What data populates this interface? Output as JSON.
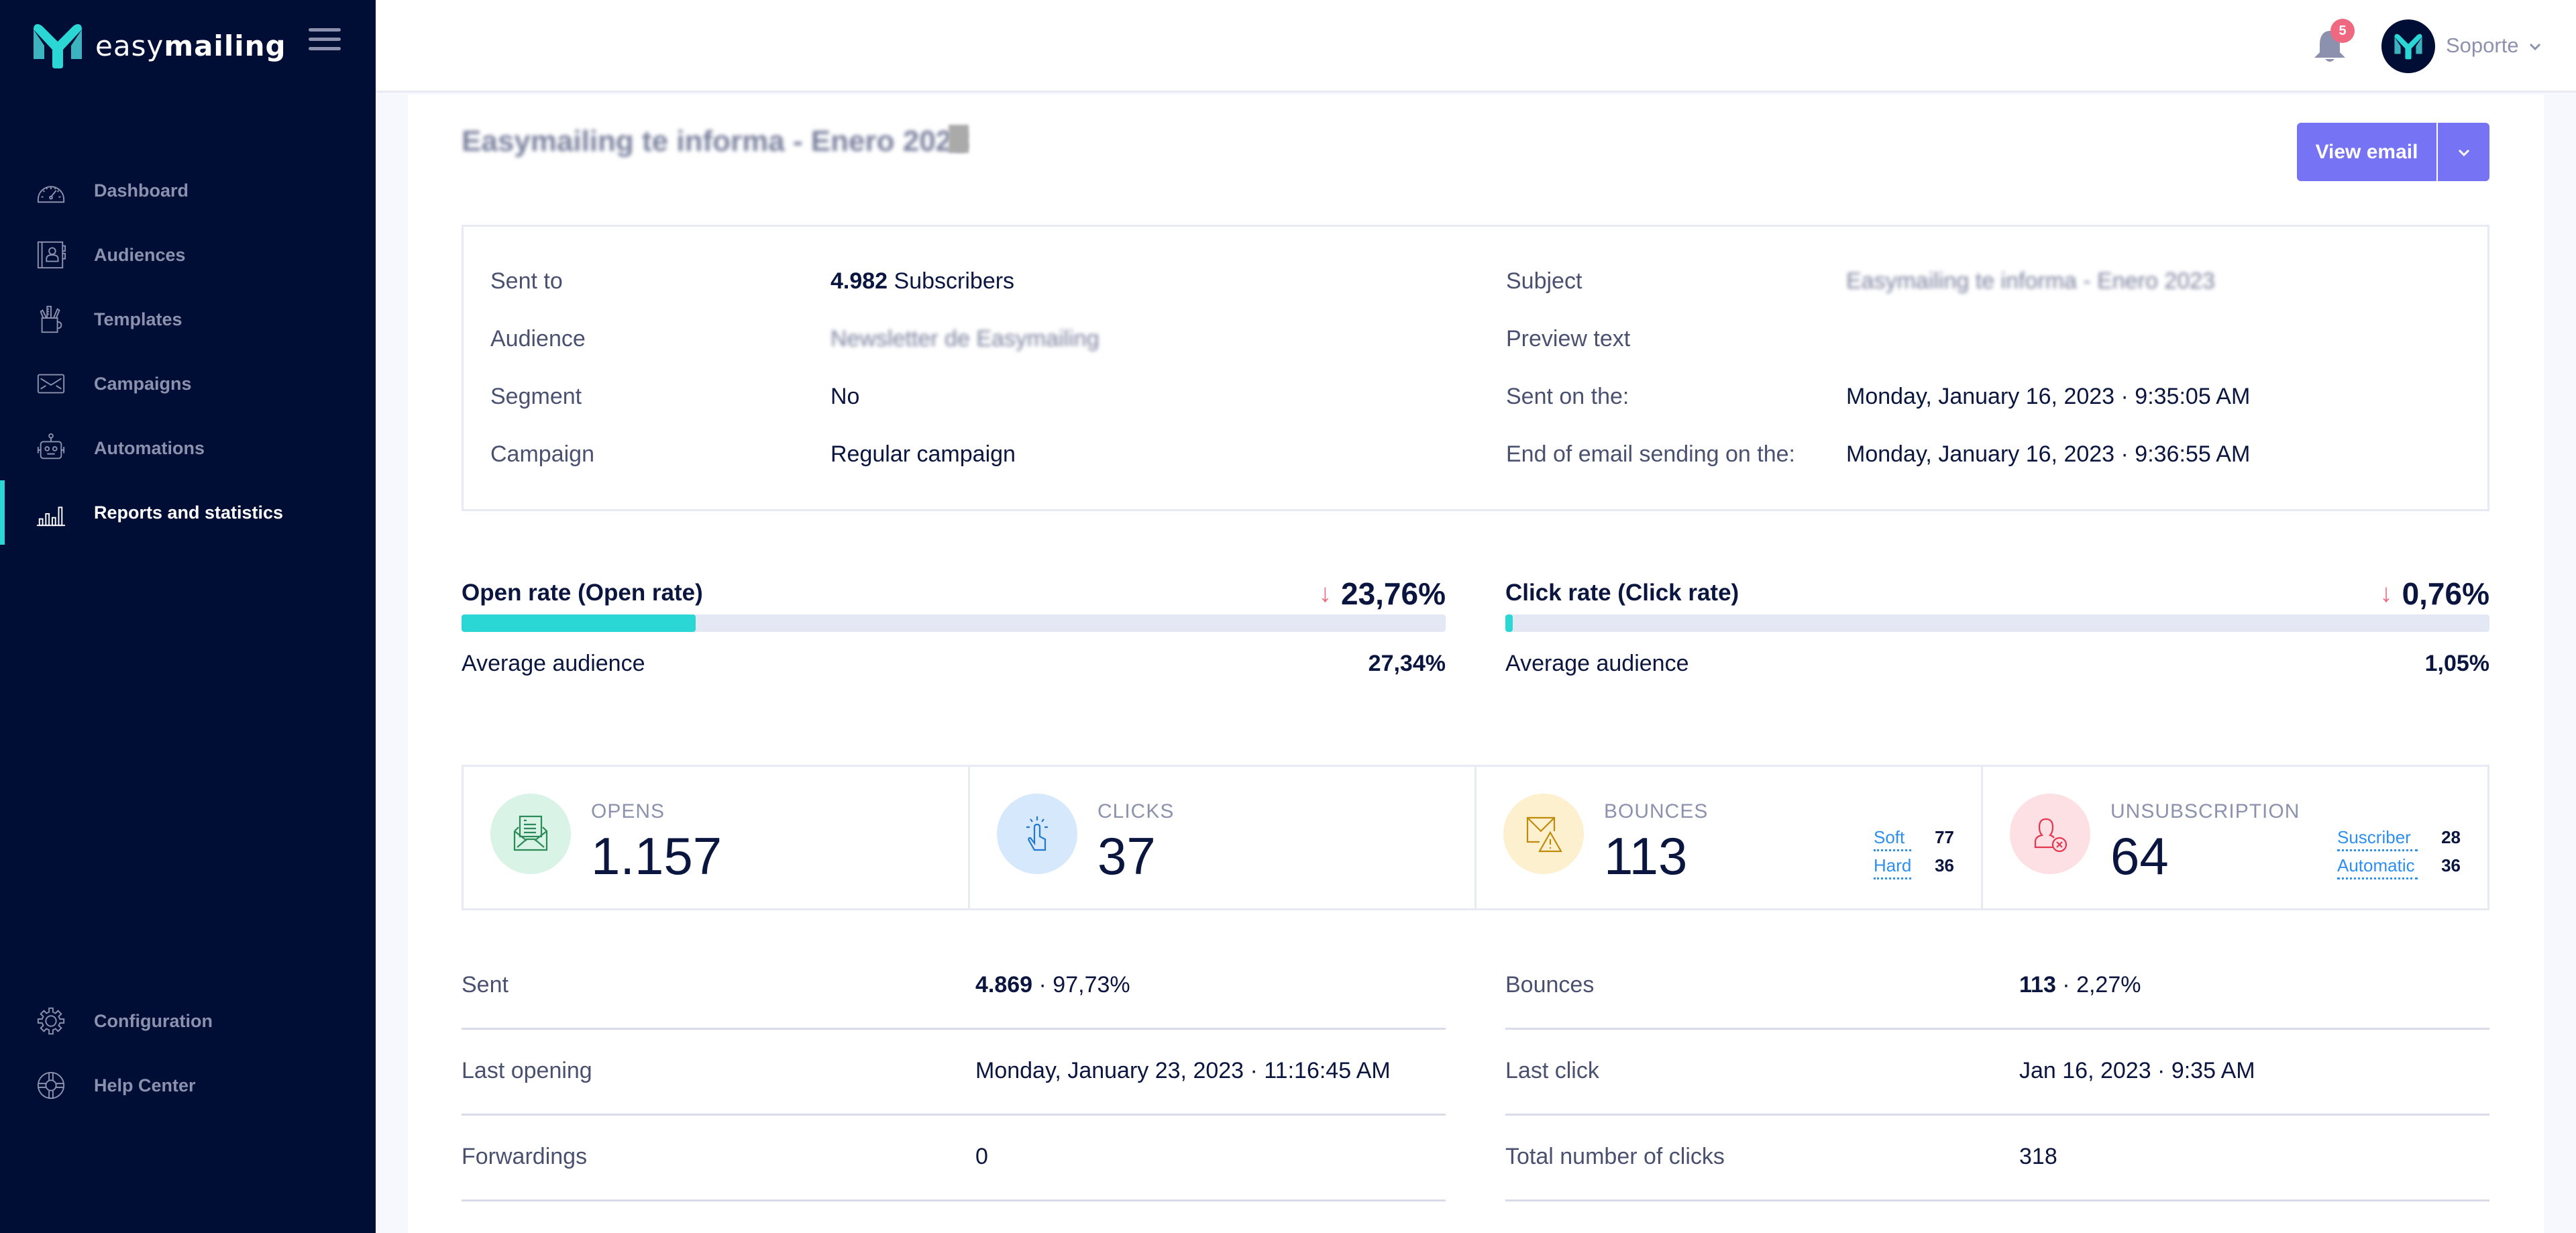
{
  "brand": {
    "name_light": "easy",
    "name_bold": "mailing",
    "accent": "#2bd7d4",
    "sidebar_bg": "#000d35",
    "primary": "#7673f4"
  },
  "sidebar": {
    "items": [
      {
        "label": "Dashboard",
        "icon": "gauge-icon",
        "active": false
      },
      {
        "label": "Audiences",
        "icon": "contact-book-icon",
        "active": false
      },
      {
        "label": "Templates",
        "icon": "pencil-cup-icon",
        "active": false
      },
      {
        "label": "Campaigns",
        "icon": "envelope-icon",
        "active": false
      },
      {
        "label": "Automations",
        "icon": "robot-icon",
        "active": false
      },
      {
        "label": "Reports and statistics",
        "icon": "bar-chart-icon",
        "active": true
      }
    ],
    "bottom_items": [
      {
        "label": "Configuration",
        "icon": "gear-icon"
      },
      {
        "label": "Help Center",
        "icon": "lifebuoy-icon"
      }
    ]
  },
  "header": {
    "notifications_count": "5",
    "user_name": "Soporte"
  },
  "campaign": {
    "title": "Easymailing te informa - Enero 2023",
    "view_email_label": "View email"
  },
  "info": {
    "left": [
      {
        "key": "Sent to",
        "value_bold": "4.982",
        "value": " Subscribers",
        "blurred": false
      },
      {
        "key": "Audience",
        "value_bold": "",
        "value": "Newsletter de Easymailing",
        "blurred": true
      },
      {
        "key": "Segment",
        "value_bold": "",
        "value": "No",
        "blurred": false
      },
      {
        "key": "Campaign",
        "value_bold": "",
        "value": "Regular campaign",
        "blurred": false
      }
    ],
    "right": [
      {
        "key": "Subject",
        "value": "Easymailing te informa - Enero 2023",
        "blurred": true
      },
      {
        "key": "Preview text",
        "value": "",
        "blurred": false
      },
      {
        "key": "Sent on the:",
        "value": "Monday, January 16, 2023 · 9:35:05 AM",
        "blurred": false
      },
      {
        "key": "End of email sending on the:",
        "value": "Monday, January 16, 2023 · 9:36:55 AM",
        "blurred": false
      }
    ]
  },
  "rates": [
    {
      "name": "Open rate (Open rate)",
      "value": "23,76%",
      "percent": 23.76,
      "trend": "down",
      "avg_label": "Average audience",
      "avg_value": "27,34%"
    },
    {
      "name": "Click rate (Click rate)",
      "value": "0,76%",
      "percent": 0.76,
      "trend": "down",
      "avg_label": "Average audience",
      "avg_value": "1,05%"
    }
  ],
  "stats": [
    {
      "label": "OPENS",
      "value": "1.157",
      "icon": "open-envelope-icon",
      "bg": "#d9f3e6",
      "fg": "#2b8a57",
      "sub": []
    },
    {
      "label": "CLICKS",
      "value": "37",
      "icon": "pointer-click-icon",
      "bg": "#d6e8fb",
      "fg": "#1f78d1",
      "sub": []
    },
    {
      "label": "BOUNCES",
      "value": "113",
      "icon": "envelope-warning-icon",
      "bg": "#fdf0cf",
      "fg": "#c08b0a",
      "sub": [
        {
          "k": "Soft",
          "v": "77"
        },
        {
          "k": "Hard",
          "v": "36"
        }
      ]
    },
    {
      "label": "UNSUBSCRIPTION",
      "value": "64",
      "icon": "user-remove-icon",
      "bg": "#fde0e4",
      "fg": "#e8364f",
      "sub": [
        {
          "k": "Suscriber",
          "v": "28"
        },
        {
          "k": "Automatic",
          "v": "36"
        }
      ]
    }
  ],
  "details": {
    "left": [
      {
        "key": "Sent",
        "value_bold": "4.869",
        "value": " · 97,73%"
      },
      {
        "key": "Last opening",
        "value_bold": "",
        "value": "Monday, January 23, 2023 · 11:16:45 AM"
      },
      {
        "key": "Forwardings",
        "value_bold": "",
        "value": "0"
      }
    ],
    "right": [
      {
        "key": "Bounces",
        "value_bold": "113",
        "value": " · 2,27%"
      },
      {
        "key": "Last click",
        "value_bold": "",
        "value": "Jan 16, 2023 · 9:35 AM"
      },
      {
        "key": "Total number of clicks",
        "value_bold": "",
        "value": "318"
      }
    ]
  }
}
